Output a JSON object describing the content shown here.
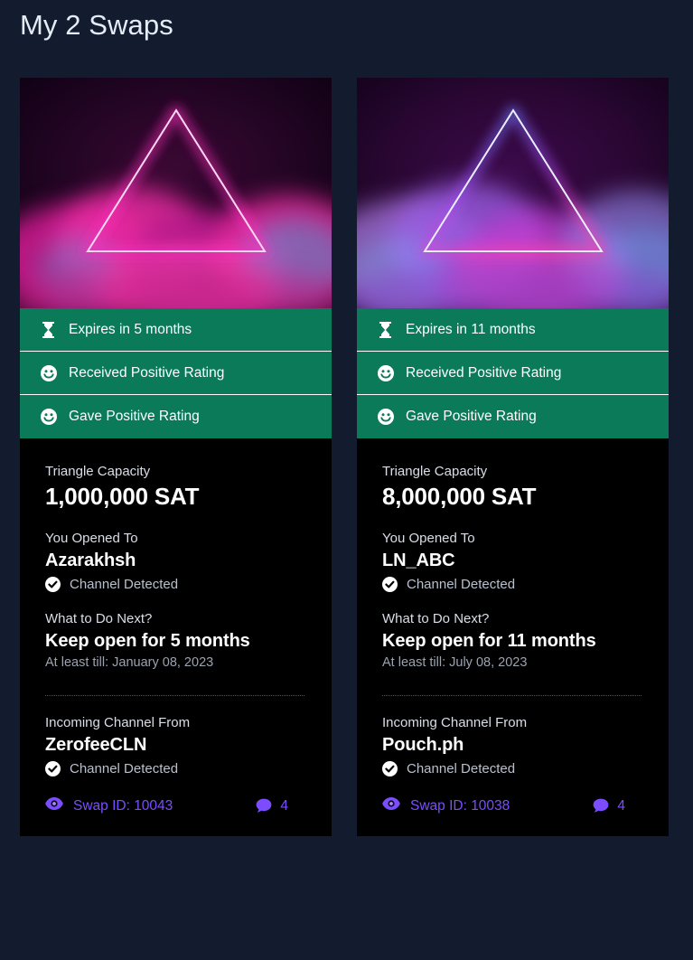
{
  "header": {
    "title": "My 2 Swaps"
  },
  "colors": {
    "page_background": "#131c2e",
    "card_background": "#000000",
    "status_green": "#0a7a59",
    "accent_purple": "#7c4dff",
    "title_text": "#e6ecf6",
    "muted_text": "#9aa3b2",
    "divider_dotted": "#4a4f8c"
  },
  "cards": [
    {
      "hero": {
        "icon": "neon-triangle-pink-smoke",
        "triangle_color": "#ff3fd0",
        "glow_color": "#ff2fc0",
        "smoke_primary": "#e81a9c",
        "smoke_secondary": "#39b5e8",
        "sky_color": "#1a0420"
      },
      "status": [
        {
          "icon": "hourglass-icon",
          "label": "Expires in 5 months"
        },
        {
          "icon": "smiley-icon",
          "label": "Received Positive Rating"
        },
        {
          "icon": "smiley-icon",
          "label": "Gave Positive Rating"
        }
      ],
      "capacity_label": "Triangle Capacity",
      "capacity_value": "1,000,000 SAT",
      "opened_label": "You Opened To",
      "opened_value": "Azarakhsh",
      "opened_detected": "Channel Detected",
      "next_label": "What to Do Next?",
      "next_value": "Keep open for 5 months",
      "next_note": "At least till: January 08, 2023",
      "incoming_label": "Incoming Channel From",
      "incoming_value": "ZerofeeCLN",
      "incoming_detected": "Channel Detected",
      "swap_id": "Swap ID: 10043",
      "comment_count": "4"
    },
    {
      "hero": {
        "icon": "neon-triangle-blue-purple-smoke",
        "triangle_color": "#3d7bff",
        "glow_color": "#4f8cff",
        "smoke_primary": "#a855f7",
        "smoke_secondary": "#6ea8ff",
        "sky_color": "#1a0628"
      },
      "status": [
        {
          "icon": "hourglass-icon",
          "label": "Expires in 11 months"
        },
        {
          "icon": "smiley-icon",
          "label": "Received Positive Rating"
        },
        {
          "icon": "smiley-icon",
          "label": "Gave Positive Rating"
        }
      ],
      "capacity_label": "Triangle Capacity",
      "capacity_value": "8,000,000 SAT",
      "opened_label": "You Opened To",
      "opened_value": "LN_ABC",
      "opened_detected": "Channel Detected",
      "next_label": "What to Do Next?",
      "next_value": "Keep open for 11 months",
      "next_note": "At least till: July 08, 2023",
      "incoming_label": "Incoming Channel From",
      "incoming_value": "Pouch.ph",
      "incoming_detected": "Channel Detected",
      "swap_id": "Swap ID: 10038",
      "comment_count": "4"
    }
  ]
}
